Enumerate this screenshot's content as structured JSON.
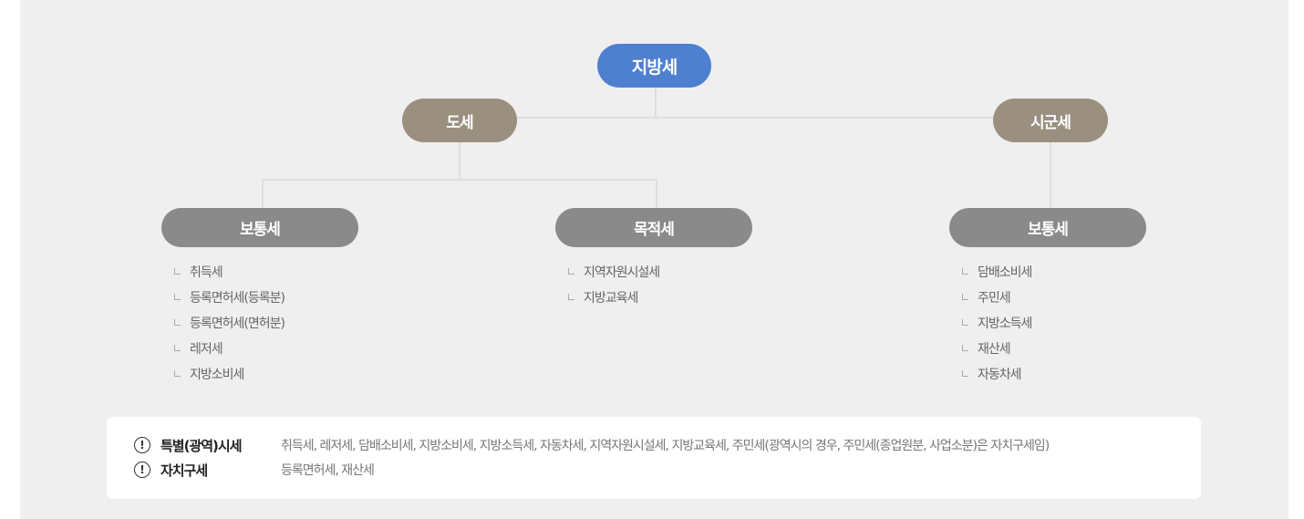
{
  "tree": {
    "root": "지방세",
    "province": {
      "label": "도세",
      "ordinary": {
        "label": "보통세",
        "items": [
          "취득세",
          "등록면허세(등록분)",
          "등록면허세(면허분)",
          "레저세",
          "지방소비세"
        ]
      },
      "purpose": {
        "label": "목적세",
        "items": [
          "지역자원시설세",
          "지방교육세"
        ]
      }
    },
    "municipal": {
      "label": "시군세",
      "ordinary": {
        "label": "보통세",
        "items": [
          "담배소비세",
          "주민세",
          "지방소득세",
          "재산세",
          "자동차세"
        ]
      }
    }
  },
  "notes": [
    {
      "icon": "exclamation-circle-icon",
      "label": "특별(광역)시세",
      "value": "취득세, 레저세, 담배소비세, 지방소비세, 지방소득세, 자동차세, 지역자원시설세, 지방교육세, 주민세(광역시의 경우, 주민세(종업원분, 사업소분)은 자치구세임)"
    },
    {
      "icon": "exclamation-circle-icon",
      "label": "자치구세",
      "value": "등록면허세, 재산세"
    }
  ],
  "colors": {
    "root": "#4f80cf",
    "branch": "#9b9080",
    "leaf": "#8a8a8a",
    "panel": "#efefef"
  }
}
